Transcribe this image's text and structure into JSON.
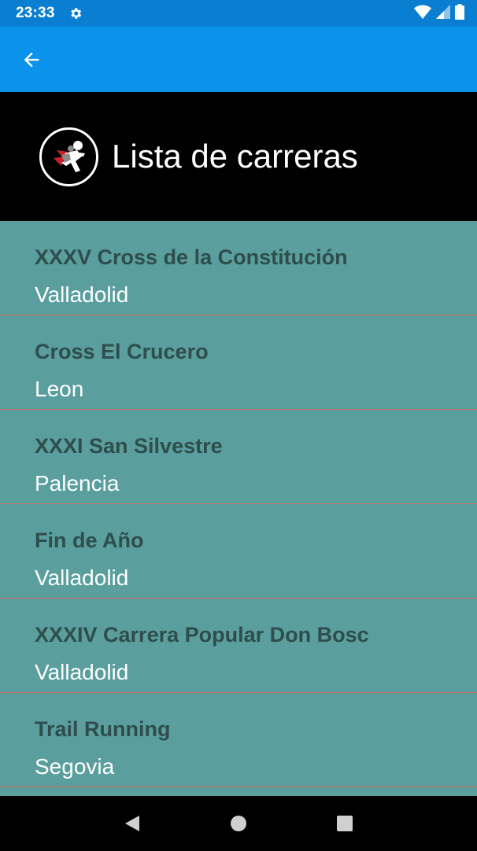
{
  "status_bar": {
    "time": "23:33"
  },
  "app_bar": {
    "back_icon": "arrow-back-icon"
  },
  "header": {
    "title": "Lista de carreras",
    "logo_icon": "runner-logo-icon"
  },
  "races": [
    {
      "name": "XXXV Cross de la Constitución",
      "city": "Valladolid"
    },
    {
      "name": "Cross El Crucero",
      "city": "Leon"
    },
    {
      "name": "XXXI San Silvestre",
      "city": "Palencia"
    },
    {
      "name": "Fin de Año",
      "city": "Valladolid"
    },
    {
      "name": "XXXIV Carrera Popular Don Bosc",
      "city": "Valladolid"
    },
    {
      "name": "Trail Running",
      "city": "Segovia"
    }
  ],
  "colors": {
    "status_bar": "#0a7fd1",
    "app_bar": "#0b93ec",
    "header": "#000000",
    "list_background": "#5a9e9e",
    "race_name": "#2f4d4d",
    "race_city": "#ffffff",
    "divider": "#c96a6a"
  },
  "nav_bar": {
    "back": "nav-back-icon",
    "home": "nav-home-icon",
    "recents": "nav-recents-icon"
  }
}
